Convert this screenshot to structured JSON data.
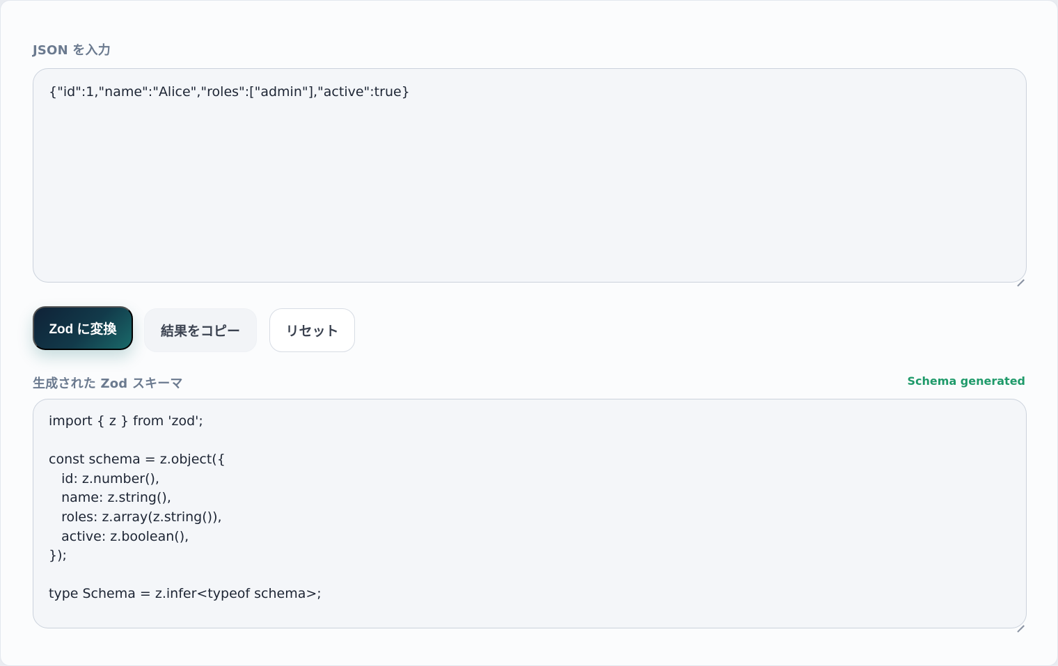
{
  "input": {
    "label": "JSON を入力",
    "value": "{\"id\":1,\"name\":\"Alice\",\"roles\":[\"admin\"],\"active\":true}"
  },
  "actions": {
    "convert_label": "Zod に変換",
    "copy_label": "結果をコピー",
    "reset_label": "リセット"
  },
  "output": {
    "label": "生成された Zod スキーマ",
    "status": "Schema generated",
    "value": "import { z } from 'zod';\n\nconst schema = z.object({\n   id: z.number(),\n   name: z.string(),\n   roles: z.array(z.string()),\n   active: z.boolean(),\n});\n\ntype Schema = z.infer<typeof schema>;"
  },
  "colors": {
    "status_success": "#1f9a6a",
    "primary_button_start": "#0f2237",
    "primary_button_end": "#1a6a6a"
  }
}
